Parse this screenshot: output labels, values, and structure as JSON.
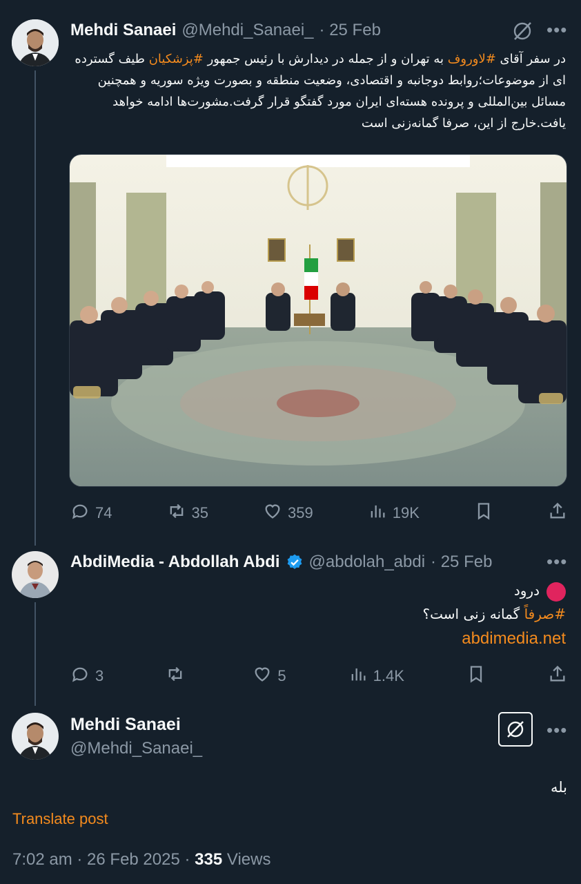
{
  "thread": {
    "tweet1": {
      "display_name": "Mehdi Sanaei",
      "handle": "@Mehdi_Sanaei_",
      "date": "· 25 Feb",
      "text_parts": [
        {
          "t": "در سفر آقای ",
          "tag": false
        },
        {
          "t": "#لاوروف",
          "tag": true
        },
        {
          "t": " به تهران و از جمله در دیدارش با رئیس جمهور ",
          "tag": false
        },
        {
          "t": "#پزشکیان",
          "tag": true
        },
        {
          "t": " طیف گسترده ای از موضوعات؛روابط دوجانبه و اقتصادی، وضعیت منطقه و بصورت ویژه سوریه و همچنین مسائل بین‌المللی و پرونده هسته‌ای ایران مورد گفتگو قرار گرفت.مشورت‌ها ادامه خواهد یافت.خارج از این، صرفا گمانه‌زنی است",
          "tag": false
        }
      ],
      "stats": {
        "replies": "74",
        "reposts": "35",
        "likes": "359",
        "views": "19K"
      }
    },
    "tweet2": {
      "display_name": "AbdiMedia - Abdollah Abdi",
      "handle": "@abdolah_abdi",
      "date": "· 25 Feb",
      "line1": "درود",
      "line2_tag": "#صرفاً",
      "line2_rest": " گمانه زنی است؟",
      "link": "abdimedia.net",
      "stats": {
        "replies": "3",
        "reposts": "",
        "likes": "5",
        "views": "1.4K"
      }
    },
    "main": {
      "display_name": "Mehdi Sanaei",
      "handle": "@Mehdi_Sanaei_",
      "text": "بله",
      "translate": "Translate post",
      "timestamp": "7:02 am · 26 Feb 2025 · ",
      "views_count": "335",
      "views_label": " Views"
    }
  },
  "icons": [
    "grok-icon",
    "more-icon",
    "reply-icon",
    "repost-icon",
    "like-icon",
    "views-icon",
    "bookmark-icon",
    "share-icon",
    "verified-icon"
  ],
  "colors": {
    "background": "#15202b",
    "accent": "#f48b1e",
    "muted": "#8b98a5",
    "verified": "#1d9bf0"
  }
}
